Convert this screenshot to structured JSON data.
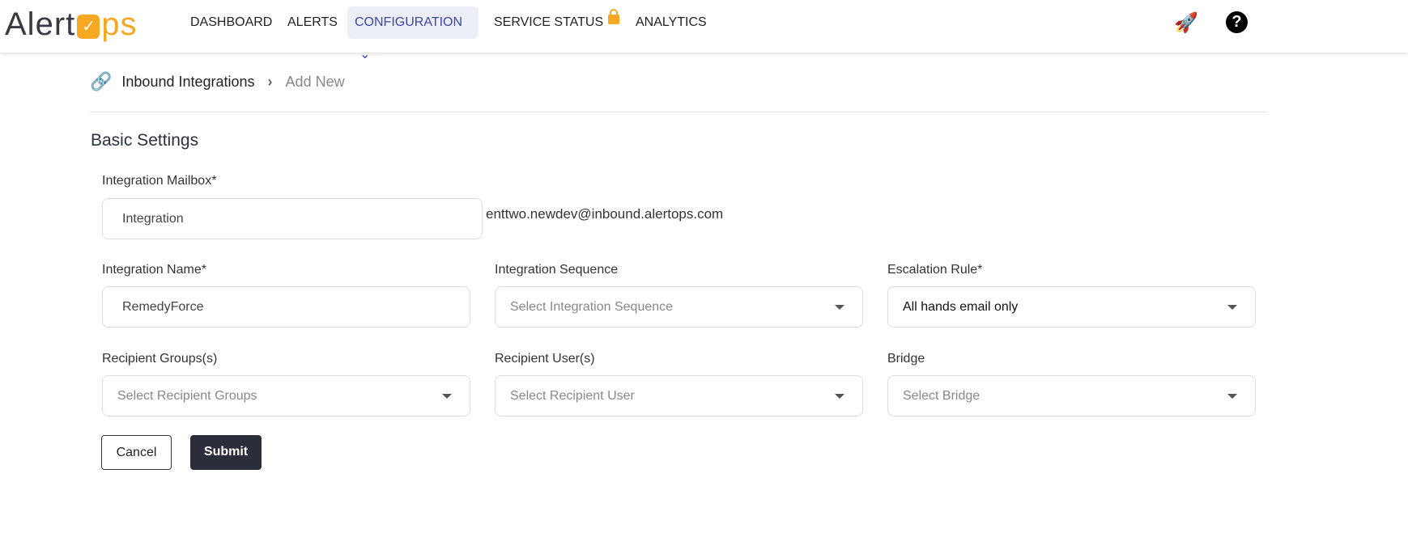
{
  "nav": {
    "logo": "AlertOps",
    "items": [
      "DASHBOARD",
      "ALERTS",
      "CONFIGURATION",
      "SERVICE STATUS",
      "ANALYTICS"
    ]
  },
  "breadcrumb": {
    "parent": "Inbound Integrations",
    "current": "Add New"
  },
  "section_title": "Basic Settings",
  "form": {
    "mailbox": {
      "label": "Integration Mailbox*",
      "value": "Integration",
      "domain": "enttwo.newdev@inbound.alertops.com"
    },
    "name": {
      "label": "Integration Name*",
      "value": "RemedyForce"
    },
    "sequence": {
      "label": "Integration Sequence",
      "placeholder": "Select Integration Sequence"
    },
    "escalation": {
      "label": "Escalation Rule*",
      "value": "All hands email only"
    },
    "groups": {
      "label": "Recipient Groups(s)",
      "placeholder": "Select Recipient Groups"
    },
    "users": {
      "label": "Recipient User(s)",
      "placeholder": "Select Recipient User"
    },
    "bridge": {
      "label": "Bridge",
      "placeholder": "Select Bridge"
    }
  },
  "buttons": {
    "cancel": "Cancel",
    "submit": "Submit"
  },
  "colors": {
    "brand": "#f7a823",
    "active_nav": "#3c45a8",
    "submit_bg": "#2b2d3b"
  }
}
